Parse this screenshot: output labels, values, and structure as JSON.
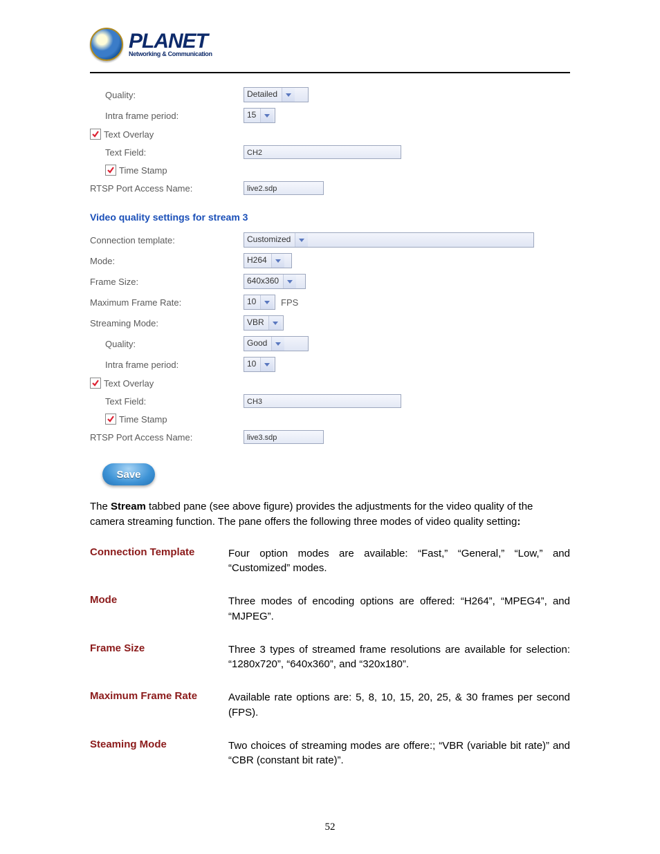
{
  "logo": {
    "name": "PLANET",
    "tagline": "Networking & Communication"
  },
  "stream2": {
    "quality_label": "Quality:",
    "quality_value": "Detailed",
    "intra_label": "Intra frame period:",
    "intra_value": "15",
    "text_overlay_label": "Text Overlay",
    "text_field_label": "Text Field:",
    "text_field_value": "CH2",
    "timestamp_label": "Time Stamp",
    "rtsp_label": "RTSP Port Access Name:",
    "rtsp_value": "live2.sdp"
  },
  "section3_heading": "Video quality settings for stream  3",
  "stream3": {
    "conn_label": "Connection template:",
    "conn_value": "Customized",
    "mode_label": "Mode:",
    "mode_value": "H264",
    "frame_size_label": "Frame Size:",
    "frame_size_value": "640x360",
    "max_rate_label": "Maximum Frame Rate:",
    "max_rate_value": "10",
    "max_rate_suffix": "FPS",
    "streaming_mode_label": "Streaming Mode:",
    "streaming_mode_value": "VBR",
    "quality_label": "Quality:",
    "quality_value": "Good",
    "intra_label": "Intra frame period:",
    "intra_value": "10",
    "text_overlay_label": "Text Overlay",
    "text_field_label": "Text Field:",
    "text_field_value": "CH3",
    "timestamp_label": "Time Stamp",
    "rtsp_label": "RTSP Port Access Name:",
    "rtsp_value": "live3.sdp"
  },
  "save_label": "Save",
  "body": {
    "p1a": "The ",
    "p1b": "Stream",
    "p1c": " tabbed pane (see above figure) provides the adjustments for the video quality of the camera streaming function. The pane offers the following three modes of video quality setting",
    "p1d": ":"
  },
  "defs": [
    {
      "term": "Connection Template",
      "desc": "Four option modes are available: “Fast,” “General,” “Low,” and “Customized” modes."
    },
    {
      "term": "Mode",
      "desc": "Three modes of encoding options are offered: “H264”, “MPEG4”, and “MJPEG”."
    },
    {
      "term": "Frame Size",
      "desc": "Three 3 types of streamed frame resolutions are available for selection: “1280x720”, “640x360”, and “320x180”."
    },
    {
      "term": "Maximum Frame Rate",
      "desc": "Available rate options are: 5, 8, 10, 15, 20, 25, & 30 frames per second (FPS)."
    },
    {
      "term": "Steaming Mode",
      "desc": "Two choices of streaming modes are offere:; “VBR (variable bit rate)” and “CBR (constant bit rate)”."
    }
  ],
  "page_number": "52"
}
